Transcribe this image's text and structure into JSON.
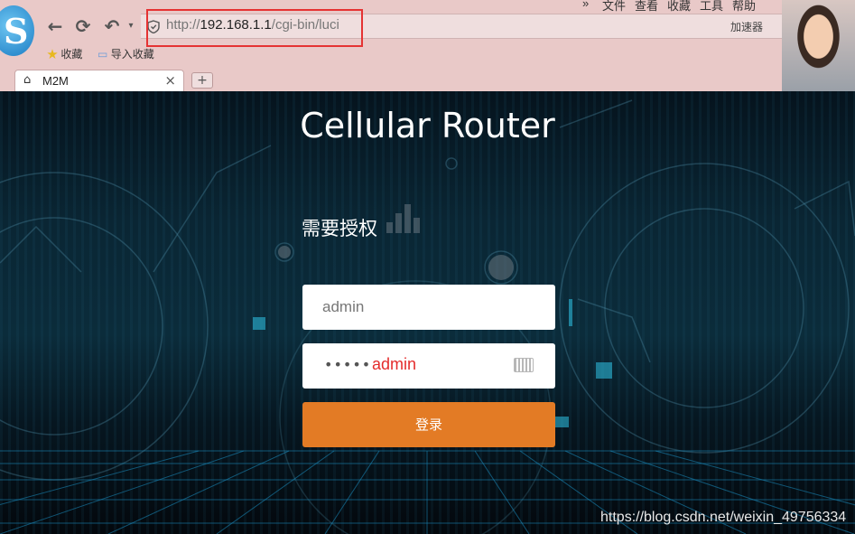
{
  "browser": {
    "url_prefix": "http://",
    "url_host": "192.168.1.1",
    "url_path": "/cgi-bin/luci",
    "menu": [
      "»",
      "文件",
      "查看",
      "收藏",
      "工具",
      "帮助"
    ],
    "accelerator": "加速器",
    "bookmarks": [
      "收藏",
      "导入收藏"
    ],
    "tab_title": "M2M",
    "new_tab": "+",
    "close": "×"
  },
  "page": {
    "title": "Cellular Router",
    "auth_heading": "需要授权",
    "username_value": "admin",
    "password_dots": "•••••",
    "password_annotation": "admin",
    "login_label": "登录",
    "watermark": "https://blog.csdn.net/weixin_49756334"
  },
  "colors": {
    "accent": "#e37b25",
    "highlight_box": "#e53333",
    "annotation": "#e42b2b"
  }
}
